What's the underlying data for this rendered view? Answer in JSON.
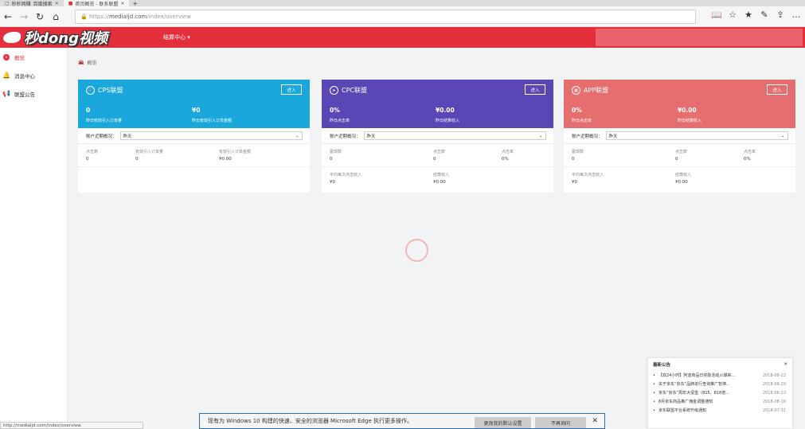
{
  "browser": {
    "tabs": [
      {
        "label": "秒秒网赚_百度搜索",
        "active": false
      },
      {
        "label": "首页概览 - 联系联盟",
        "active": true
      }
    ],
    "url_prefix": "https://",
    "url_host": "medialjd.com",
    "url_path": "/index/overview",
    "status_url": "http://medialjd.com/index/overview"
  },
  "header": {
    "brand": "秒dong视频",
    "account_menu": "结算中心 ▾"
  },
  "sidebar": {
    "items": [
      {
        "label": "概览",
        "icon": "home-icon",
        "active": true
      },
      {
        "label": "消息中心",
        "icon": "bell-icon",
        "active": false
      },
      {
        "label": "联盟公告",
        "icon": "megaphone-icon",
        "active": false
      }
    ]
  },
  "breadcrumb": {
    "label": "概览"
  },
  "colors": {
    "cps": "#1aa8dc",
    "cpc": "#5a46b4",
    "app": "#e76e6e",
    "brand_red": "#e32e3b"
  },
  "cards": [
    {
      "title": "CPS联盟",
      "enter": "进入",
      "stat1": "0",
      "stat1_label": "昨日有效引入订单量",
      "stat2": "¥0",
      "stat2_label": "昨日有效引入订单金额",
      "select_label": "账户近期概况：",
      "select_value": "昨天",
      "rows": [
        [
          {
            "label": "点击数",
            "value": "0"
          },
          {
            "label": "有效引入订单量",
            "value": "0"
          },
          {
            "label": "有效引入订单金额",
            "value": "¥0.00"
          }
        ]
      ]
    },
    {
      "title": "CPC联盟",
      "enter": "进入",
      "stat1": "0%",
      "stat1_label": "昨日点击率",
      "stat2": "¥0.00",
      "stat2_label": "昨日结算收入",
      "select_label": "账户近期概况：",
      "select_value": "昨天",
      "rows": [
        [
          {
            "label": "展现数",
            "value": "0"
          },
          {
            "label": "点击数",
            "value": "0"
          },
          {
            "label": "点击率",
            "value": "0%"
          }
        ],
        [
          {
            "label": "平均每次点击收入",
            "value": "¥0"
          },
          {
            "label": "结算收入",
            "value": "¥0.00"
          }
        ]
      ]
    },
    {
      "title": "APP联盟",
      "enter": "进入",
      "stat1": "0%",
      "stat1_label": "昨日点击率",
      "stat2": "¥0.00",
      "stat2_label": "昨日结算收入",
      "select_label": "账户近期概况：",
      "select_value": "昨天",
      "rows": [
        [
          {
            "label": "展现数",
            "value": "0"
          },
          {
            "label": "点击数",
            "value": "0"
          },
          {
            "label": "点击率",
            "value": "0%"
          }
        ],
        [
          {
            "label": "平均每次点击收入",
            "value": "¥0"
          },
          {
            "label": "结算收入",
            "value": "¥0.00"
          }
        ]
      ]
    }
  ],
  "notice": {
    "title": "最新公告",
    "items": [
      {
        "title": "【双24小时】阿迪商品日奖励活动火爆来...",
        "date": "2018-08-22"
      },
      {
        "title": "关于京东“京东”品牌进行查询推广暂停...",
        "date": "2018-08-20"
      },
      {
        "title": "京东“京东”周年大促盒（815、818倍...",
        "date": "2018-08-13"
      },
      {
        "title": "8月京东商品推广佣金调整通知",
        "date": "2018-08-10"
      },
      {
        "title": "京东联盟平台系统升级通知",
        "date": "2018-07-31"
      }
    ]
  },
  "edge_bar": {
    "message": "现有为 Windows 10 构建的快速、安全的浏览器 Microsoft Edge 执行更多操作。",
    "btn_default": "更改我的默认设置",
    "btn_never": "不再询问"
  }
}
